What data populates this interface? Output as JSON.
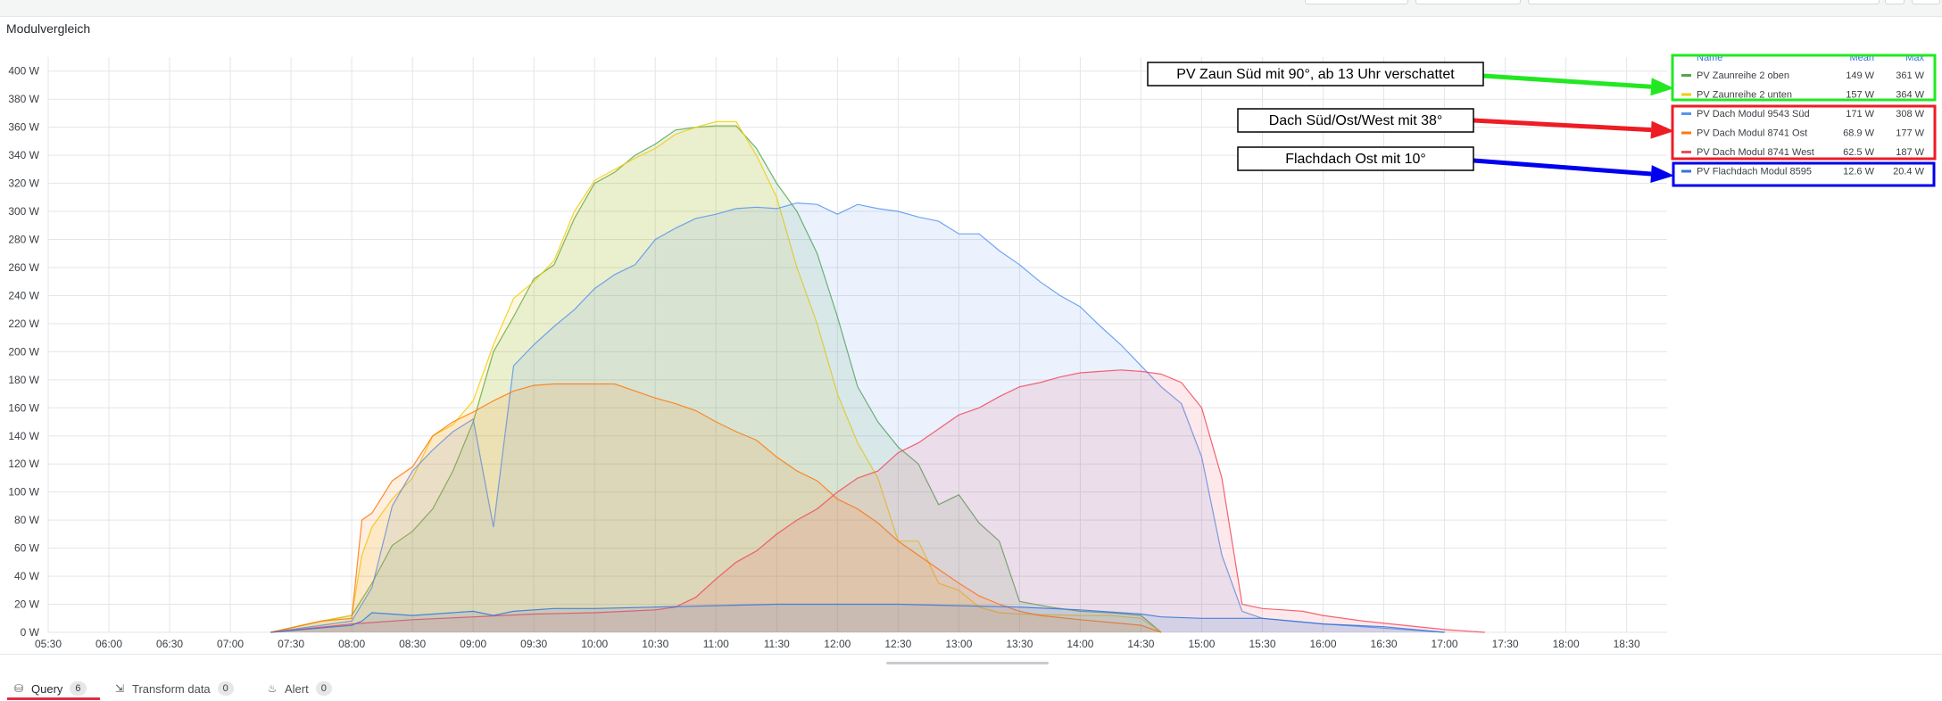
{
  "panel": {
    "title": "Modulvergleich"
  },
  "tabs": [
    {
      "label": "Query",
      "count": "6",
      "icon": "database-icon",
      "active": true
    },
    {
      "label": "Transform data",
      "count": "0",
      "icon": "transform-icon",
      "active": false
    },
    {
      "label": "Alert",
      "count": "0",
      "icon": "bell-icon",
      "active": false
    }
  ],
  "legend": {
    "headers": {
      "name": "Name",
      "mean": "Mean",
      "max": "Max"
    },
    "rows": [
      {
        "name": "PV Zaunreihe 2 oben",
        "mean": "149 W",
        "max": "361 W",
        "color": "#56a64b"
      },
      {
        "name": "PV Zaunreihe 2 unten",
        "mean": "157 W",
        "max": "364 W",
        "color": "#f2cc0c"
      },
      {
        "name": "PV Dach Modul 9543 Süd",
        "mean": "171 W",
        "max": "308 W",
        "color": "#5794f2"
      },
      {
        "name": "PV Dach Modul 8741 Ost",
        "mean": "68.9 W",
        "max": "177 W",
        "color": "#ff780a"
      },
      {
        "name": "PV Dach Modul 8741 West",
        "mean": "62.5 W",
        "max": "187 W",
        "color": "#f2495c"
      },
      {
        "name": "PV Flachdach Modul 8595",
        "mean": "12.6 W",
        "max": "20.4 W",
        "color": "#3274d9"
      }
    ]
  },
  "annotations": [
    {
      "text": "PV Zaun Süd mit 90°, ab 13 Uhr verschattet",
      "color": "#22e822"
    },
    {
      "text": "Dach Süd/Ost/West mit 38°",
      "color": "#ee1c24"
    },
    {
      "text": "Flachdach Ost mit 10°",
      "color": "#0000ee"
    }
  ],
  "chart_data": {
    "type": "area",
    "title": "Modulvergleich",
    "x_ticks": [
      "05:30",
      "06:00",
      "06:30",
      "07:00",
      "07:30",
      "08:00",
      "08:30",
      "09:00",
      "09:30",
      "10:00",
      "10:30",
      "11:00",
      "11:30",
      "12:00",
      "12:30",
      "13:00",
      "13:30",
      "14:00",
      "14:30",
      "15:00",
      "15:30",
      "16:00",
      "16:30",
      "17:00",
      "17:30",
      "18:00",
      "18:30"
    ],
    "y_ticks": [
      "0 W",
      "20 W",
      "40 W",
      "60 W",
      "80 W",
      "100 W",
      "120 W",
      "140 W",
      "160 W",
      "180 W",
      "200 W",
      "220 W",
      "240 W",
      "260 W",
      "280 W",
      "300 W",
      "320 W",
      "340 W",
      "360 W",
      "380 W",
      "400 W"
    ],
    "xlim": [
      "05:30",
      "18:50"
    ],
    "ylim": [
      0,
      410
    ],
    "y_unit": "W",
    "grid": true,
    "legend_position": "top-right",
    "series": [
      {
        "name": "PV Zaunreihe 2 oben",
        "color": "#56a64b",
        "points": [
          [
            "07:20",
            0
          ],
          [
            "07:45",
            8
          ],
          [
            "08:00",
            12
          ],
          [
            "08:10",
            35
          ],
          [
            "08:20",
            62
          ],
          [
            "08:30",
            72
          ],
          [
            "08:40",
            88
          ],
          [
            "08:50",
            115
          ],
          [
            "09:00",
            150
          ],
          [
            "09:10",
            200
          ],
          [
            "09:20",
            225
          ],
          [
            "09:30",
            252
          ],
          [
            "09:40",
            262
          ],
          [
            "09:50",
            295
          ],
          [
            "10:00",
            320
          ],
          [
            "10:10",
            328
          ],
          [
            "10:20",
            340
          ],
          [
            "10:30",
            348
          ],
          [
            "10:40",
            358
          ],
          [
            "10:50",
            360
          ],
          [
            "11:00",
            361
          ],
          [
            "11:10",
            361
          ],
          [
            "11:20",
            345
          ],
          [
            "11:30",
            320
          ],
          [
            "11:40",
            300
          ],
          [
            "11:50",
            270
          ],
          [
            "12:00",
            225
          ],
          [
            "12:10",
            175
          ],
          [
            "12:20",
            150
          ],
          [
            "12:30",
            132
          ],
          [
            "12:40",
            120
          ],
          [
            "12:50",
            91
          ],
          [
            "13:00",
            98
          ],
          [
            "13:10",
            78
          ],
          [
            "13:20",
            65
          ],
          [
            "13:30",
            22
          ],
          [
            "13:45",
            18
          ],
          [
            "14:00",
            15
          ],
          [
            "14:15",
            14
          ],
          [
            "14:30",
            12
          ],
          [
            "14:40",
            0
          ]
        ]
      },
      {
        "name": "PV Zaunreihe 2 unten",
        "color": "#f2cc0c",
        "points": [
          [
            "07:20",
            0
          ],
          [
            "07:45",
            8
          ],
          [
            "08:00",
            12
          ],
          [
            "08:05",
            55
          ],
          [
            "08:10",
            75
          ],
          [
            "08:20",
            95
          ],
          [
            "08:30",
            110
          ],
          [
            "08:40",
            140
          ],
          [
            "08:50",
            148
          ],
          [
            "09:00",
            165
          ],
          [
            "09:10",
            205
          ],
          [
            "09:20",
            238
          ],
          [
            "09:30",
            250
          ],
          [
            "09:40",
            265
          ],
          [
            "09:50",
            300
          ],
          [
            "10:00",
            322
          ],
          [
            "10:10",
            330
          ],
          [
            "10:20",
            338
          ],
          [
            "10:30",
            345
          ],
          [
            "10:40",
            355
          ],
          [
            "10:50",
            360
          ],
          [
            "11:00",
            364
          ],
          [
            "11:10",
            364
          ],
          [
            "11:20",
            340
          ],
          [
            "11:30",
            310
          ],
          [
            "11:40",
            260
          ],
          [
            "11:50",
            220
          ],
          [
            "12:00",
            170
          ],
          [
            "12:10",
            135
          ],
          [
            "12:20",
            110
          ],
          [
            "12:30",
            65
          ],
          [
            "12:40",
            65
          ],
          [
            "12:50",
            35
          ],
          [
            "13:00",
            30
          ],
          [
            "13:10",
            18
          ],
          [
            "13:20",
            14
          ],
          [
            "13:30",
            13
          ],
          [
            "14:00",
            12
          ],
          [
            "14:15",
            12
          ],
          [
            "14:30",
            10
          ],
          [
            "14:40",
            0
          ]
        ]
      },
      {
        "name": "PV Dach Modul 9543 Süd",
        "color": "#5794f2",
        "points": [
          [
            "07:20",
            0
          ],
          [
            "07:45",
            5
          ],
          [
            "08:00",
            8
          ],
          [
            "08:10",
            32
          ],
          [
            "08:20",
            90
          ],
          [
            "08:30",
            115
          ],
          [
            "08:40",
            130
          ],
          [
            "08:50",
            143
          ],
          [
            "09:00",
            152
          ],
          [
            "09:10",
            75
          ],
          [
            "09:20",
            190
          ],
          [
            "09:30",
            205
          ],
          [
            "09:40",
            218
          ],
          [
            "09:50",
            230
          ],
          [
            "10:00",
            245
          ],
          [
            "10:10",
            255
          ],
          [
            "10:20",
            262
          ],
          [
            "10:30",
            280
          ],
          [
            "10:40",
            288
          ],
          [
            "10:50",
            295
          ],
          [
            "11:00",
            298
          ],
          [
            "11:10",
            302
          ],
          [
            "11:20",
            303
          ],
          [
            "11:30",
            302
          ],
          [
            "11:40",
            306
          ],
          [
            "11:50",
            305
          ],
          [
            "12:00",
            298
          ],
          [
            "12:10",
            305
          ],
          [
            "12:20",
            302
          ],
          [
            "12:30",
            300
          ],
          [
            "12:40",
            296
          ],
          [
            "12:50",
            293
          ],
          [
            "13:00",
            284
          ],
          [
            "13:10",
            284
          ],
          [
            "13:20",
            272
          ],
          [
            "13:30",
            262
          ],
          [
            "13:40",
            250
          ],
          [
            "13:50",
            240
          ],
          [
            "14:00",
            232
          ],
          [
            "14:10",
            218
          ],
          [
            "14:20",
            205
          ],
          [
            "14:30",
            190
          ],
          [
            "14:40",
            175
          ],
          [
            "14:50",
            163
          ],
          [
            "15:00",
            125
          ],
          [
            "15:10",
            55
          ],
          [
            "15:20",
            15
          ],
          [
            "15:30",
            10
          ],
          [
            "15:45",
            8
          ],
          [
            "16:00",
            6
          ],
          [
            "16:30",
            3
          ],
          [
            "17:00",
            0
          ]
        ]
      },
      {
        "name": "PV Dach Modul 8741 Ost",
        "color": "#ff780a",
        "points": [
          [
            "07:20",
            0
          ],
          [
            "07:45",
            8
          ],
          [
            "08:00",
            10
          ],
          [
            "08:05",
            80
          ],
          [
            "08:10",
            85
          ],
          [
            "08:20",
            108
          ],
          [
            "08:30",
            118
          ],
          [
            "08:40",
            140
          ],
          [
            "08:50",
            150
          ],
          [
            "09:00",
            157
          ],
          [
            "09:10",
            165
          ],
          [
            "09:20",
            172
          ],
          [
            "09:30",
            176
          ],
          [
            "09:40",
            177
          ],
          [
            "10:00",
            177
          ],
          [
            "10:10",
            177
          ],
          [
            "10:20",
            172
          ],
          [
            "10:30",
            167
          ],
          [
            "10:40",
            163
          ],
          [
            "10:50",
            158
          ],
          [
            "11:00",
            150
          ],
          [
            "11:10",
            143
          ],
          [
            "11:20",
            137
          ],
          [
            "11:30",
            125
          ],
          [
            "11:40",
            115
          ],
          [
            "11:50",
            108
          ],
          [
            "12:00",
            95
          ],
          [
            "12:10",
            88
          ],
          [
            "12:20",
            78
          ],
          [
            "12:30",
            65
          ],
          [
            "12:40",
            55
          ],
          [
            "12:50",
            45
          ],
          [
            "13:00",
            35
          ],
          [
            "13:10",
            26
          ],
          [
            "13:20",
            20
          ],
          [
            "13:30",
            15
          ],
          [
            "13:40",
            12
          ],
          [
            "14:00",
            9
          ],
          [
            "14:30",
            5
          ],
          [
            "14:40",
            0
          ]
        ]
      },
      {
        "name": "PV Dach Modul 8741 West",
        "color": "#f2495c",
        "points": [
          [
            "07:20",
            0
          ],
          [
            "08:00",
            6
          ],
          [
            "08:30",
            9
          ],
          [
            "09:00",
            11
          ],
          [
            "09:30",
            13
          ],
          [
            "10:00",
            14
          ],
          [
            "10:30",
            16
          ],
          [
            "10:40",
            18
          ],
          [
            "10:50",
            25
          ],
          [
            "11:00",
            38
          ],
          [
            "11:10",
            50
          ],
          [
            "11:20",
            58
          ],
          [
            "11:30",
            70
          ],
          [
            "11:40",
            80
          ],
          [
            "11:50",
            88
          ],
          [
            "12:00",
            100
          ],
          [
            "12:10",
            110
          ],
          [
            "12:20",
            115
          ],
          [
            "12:30",
            128
          ],
          [
            "12:40",
            135
          ],
          [
            "12:50",
            145
          ],
          [
            "13:00",
            155
          ],
          [
            "13:10",
            160
          ],
          [
            "13:20",
            168
          ],
          [
            "13:30",
            175
          ],
          [
            "13:40",
            178
          ],
          [
            "13:50",
            182
          ],
          [
            "14:00",
            185
          ],
          [
            "14:10",
            186
          ],
          [
            "14:20",
            187
          ],
          [
            "14:30",
            186
          ],
          [
            "14:40",
            184
          ],
          [
            "14:50",
            178
          ],
          [
            "15:00",
            160
          ],
          [
            "15:10",
            110
          ],
          [
            "15:20",
            20
          ],
          [
            "15:30",
            17
          ],
          [
            "15:40",
            16
          ],
          [
            "15:50",
            15
          ],
          [
            "16:00",
            12
          ],
          [
            "16:20",
            8
          ],
          [
            "16:40",
            5
          ],
          [
            "17:00",
            2
          ],
          [
            "17:20",
            0
          ]
        ]
      },
      {
        "name": "PV Flachdach Modul 8595",
        "color": "#3274d9",
        "points": [
          [
            "07:20",
            0
          ],
          [
            "08:00",
            5
          ],
          [
            "08:05",
            8
          ],
          [
            "08:10",
            14
          ],
          [
            "08:30",
            12
          ],
          [
            "09:00",
            15
          ],
          [
            "09:10",
            12
          ],
          [
            "09:20",
            15
          ],
          [
            "09:40",
            17
          ],
          [
            "10:00",
            17
          ],
          [
            "10:30",
            18
          ],
          [
            "11:00",
            19
          ],
          [
            "11:30",
            20
          ],
          [
            "12:00",
            20
          ],
          [
            "12:30",
            20
          ],
          [
            "13:00",
            19
          ],
          [
            "13:30",
            18
          ],
          [
            "14:00",
            16
          ],
          [
            "14:30",
            13
          ],
          [
            "14:40",
            11
          ],
          [
            "15:00",
            10
          ],
          [
            "15:30",
            10
          ],
          [
            "16:00",
            6
          ],
          [
            "16:30",
            4
          ],
          [
            "17:00",
            0
          ]
        ]
      }
    ]
  }
}
